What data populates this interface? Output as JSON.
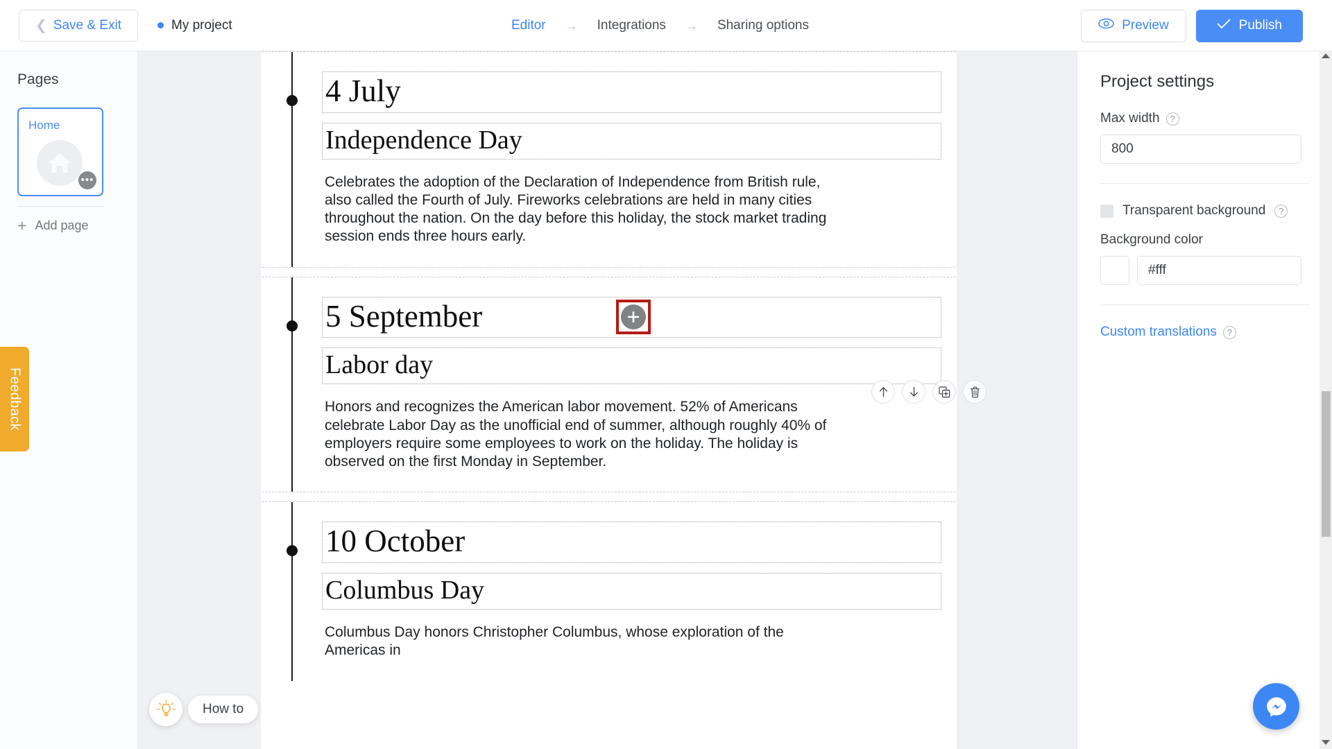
{
  "topbar": {
    "save_exit_label": "Save & Exit",
    "back_chevron_icon": "chevron-left-icon",
    "project_status_icon": "status-dot-icon",
    "project_title": "My project",
    "breadcrumb": [
      {
        "label": "Editor",
        "active": true
      },
      {
        "label": "Integrations",
        "active": false
      },
      {
        "label": "Sharing options",
        "active": false
      }
    ],
    "breadcrumb_arrow": "→",
    "preview_label": "Preview",
    "preview_icon": "eye-icon",
    "publish_label": "Publish",
    "publish_icon": "check-icon",
    "publish_color": "#4a8df6"
  },
  "sidebar": {
    "heading": "Pages",
    "page_card": {
      "title": "Home",
      "thumb_icon": "home-icon",
      "more_icon": "ellipsis-icon",
      "more_label": "•••"
    },
    "add_page_label": "Add page",
    "add_page_icon": "plus-icon"
  },
  "feedback": {
    "label": "Feedback",
    "color": "#f0aa2c"
  },
  "howto": {
    "label": "How to",
    "icon": "lightbulb-icon"
  },
  "canvas": {
    "add_block_icon": "plus-circle-icon",
    "add_block_highlight_color": "#b51b15",
    "toolbar": [
      {
        "name": "move-up-button",
        "icon": "arrow-up-icon",
        "glyph": "↑"
      },
      {
        "name": "move-down-button",
        "icon": "arrow-down-icon",
        "glyph": "↓"
      },
      {
        "name": "duplicate-button",
        "icon": "copy-icon",
        "glyph": "⧉"
      },
      {
        "name": "delete-button",
        "icon": "trash-icon",
        "glyph": "🗑"
      }
    ],
    "blocks": [
      {
        "date": "4 July",
        "name": "Independence Day",
        "text": "Celebrates the adoption of the Declaration of Independence from British rule, also called the Fourth of July. Fireworks celebrations are held in many cities throughout the nation. On the day before this holiday, the stock market trading session ends three hours early."
      },
      {
        "date": "5 September",
        "name": "Labor day",
        "text": "Honors and recognizes the American labor movement. 52% of Americans celebrate Labor Day as the unofficial end of summer, although roughly 40% of employers require some employees to work on the holiday. The holiday is observed on the first Monday in September."
      },
      {
        "date": "10 October",
        "name": "Columbus Day",
        "text": "Columbus Day honors Christopher Columbus, whose exploration of the Americas in"
      }
    ]
  },
  "rightpanel": {
    "title": "Project settings",
    "max_width_label": "Max width",
    "max_width_value": "800",
    "help_icon": "question-mark-icon",
    "help_glyph": "?",
    "transparent_bg_label": "Transparent background",
    "transparent_bg_checked": false,
    "background_color_label": "Background color",
    "background_color_value": "#fff",
    "background_color_swatch": "#ffffff",
    "custom_translations_label": "Custom translations"
  },
  "messenger": {
    "icon": "messenger-icon",
    "color": "#3d87f5"
  }
}
